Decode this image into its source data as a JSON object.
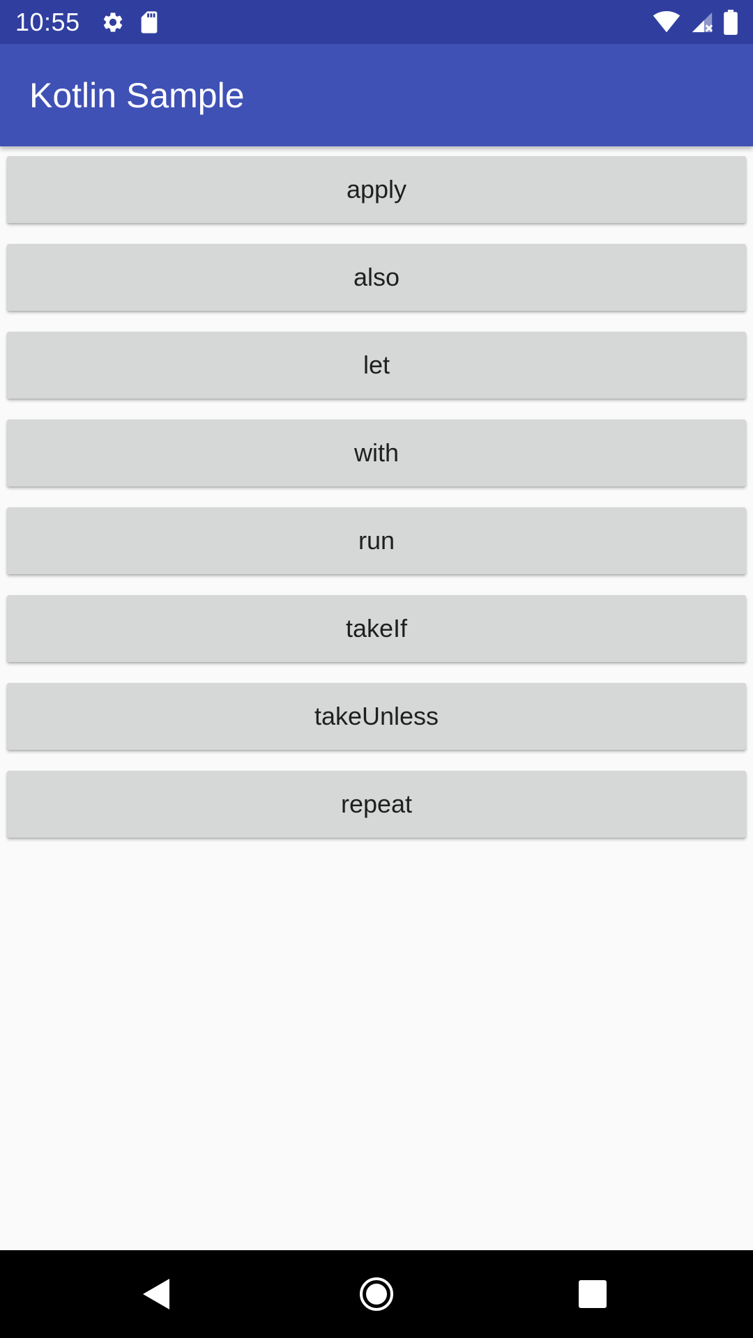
{
  "status_bar": {
    "time": "10:55",
    "left_icons": [
      "settings-icon",
      "sd-card-icon"
    ],
    "right_icons": [
      "wifi-icon",
      "cellular-no-signal-icon",
      "battery-icon"
    ]
  },
  "app_bar": {
    "title": "Kotlin Sample",
    "color": "#3f51b5"
  },
  "buttons": [
    {
      "label": "apply"
    },
    {
      "label": "also"
    },
    {
      "label": "let"
    },
    {
      "label": "with"
    },
    {
      "label": "run"
    },
    {
      "label": "takeIf"
    },
    {
      "label": "takeUnless"
    },
    {
      "label": "repeat"
    }
  ],
  "nav_bar": {
    "icons": [
      "back-icon",
      "home-icon",
      "recents-icon"
    ]
  },
  "colors": {
    "status_bar": "#303f9f",
    "app_bar": "#3f51b5",
    "button_bg": "#d6d7d7",
    "background": "#fafafa"
  }
}
